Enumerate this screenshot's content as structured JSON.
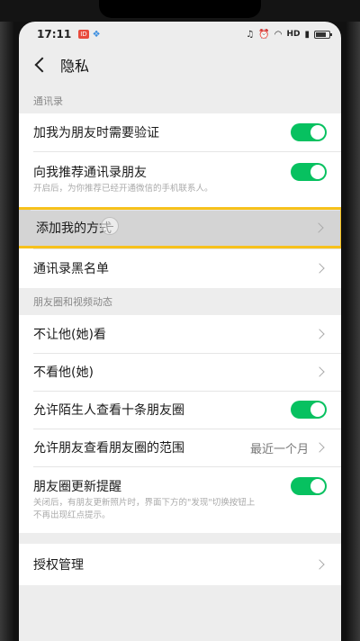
{
  "status_bar": {
    "time": "17:11",
    "badge": "ID",
    "app_icon": "app-notification-icon",
    "right_text": "HD",
    "battery_icon": "battery-icon"
  },
  "nav": {
    "back_icon": "chevron-left-icon",
    "title": "隐私"
  },
  "sections": {
    "contacts": {
      "header": "通讯录",
      "verify_label": "加我为朋友时需要验证",
      "verify_on": true,
      "recommend_label": "向我推荐通讯录朋友",
      "recommend_on": true,
      "recommend_desc": "开启后，为你推荐已经开通微信的手机联系人。",
      "add_me_label": "添加我的方式",
      "blacklist_label": "通讯录黑名单"
    },
    "moments": {
      "header": "朋友圈和视频动态",
      "hide_from_label": "不让他(她)看",
      "dont_see_label": "不看他(她)",
      "strangers_label": "允许陌生人查看十条朋友圈",
      "strangers_on": true,
      "range_label": "允许朋友查看朋友圈的范围",
      "range_value": "最近一个月",
      "update_label": "朋友圈更新提醒",
      "update_on": true,
      "update_desc_1": "关闭后，有朋友更新照片时，界面下方的\"发现\"切换按钮上",
      "update_desc_2": "不再出现红点提示。"
    },
    "auth": {
      "label": "授权管理"
    }
  },
  "colors": {
    "toggle_on": "#07c160",
    "highlight_border": "#f7c11b",
    "background": "#ededed"
  }
}
